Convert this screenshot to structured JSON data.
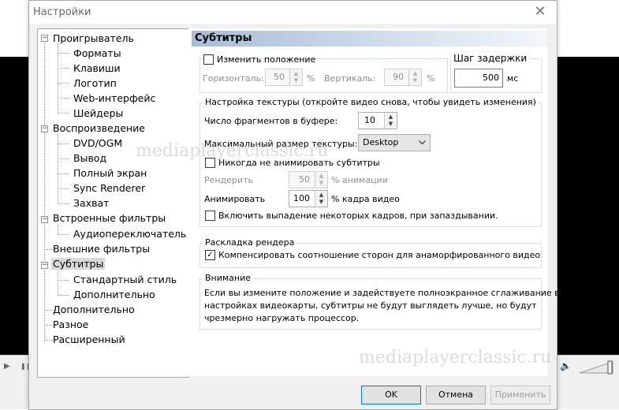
{
  "watermark": "mediaplayerclassic.ru",
  "dialog": {
    "title": "Настройки",
    "close_glyph": "✕"
  },
  "tree": {
    "items": [
      {
        "label": "Проигрыватель",
        "level": 0,
        "expanded": true
      },
      {
        "label": "Форматы",
        "level": 1
      },
      {
        "label": "Клавиши",
        "level": 1
      },
      {
        "label": "Логотип",
        "level": 1
      },
      {
        "label": "Web-интерфейс",
        "level": 1
      },
      {
        "label": "Шейдеры",
        "level": 1
      },
      {
        "label": "Воспроизведение",
        "level": 0,
        "expanded": true
      },
      {
        "label": "DVD/OGM",
        "level": 1
      },
      {
        "label": "Вывод",
        "level": 1
      },
      {
        "label": "Полный экран",
        "level": 1
      },
      {
        "label": "Sync Renderer",
        "level": 1
      },
      {
        "label": "Захват",
        "level": 1
      },
      {
        "label": "Встроенные фильтры",
        "level": 0,
        "expanded": true
      },
      {
        "label": "Аудиопереключатель",
        "level": 1
      },
      {
        "label": "Внешние фильтры",
        "level": 0
      },
      {
        "label": "Субтитры",
        "level": 0,
        "expanded": true,
        "selected": true
      },
      {
        "label": "Стандартный стиль",
        "level": 1
      },
      {
        "label": "Дополнительно",
        "level": 1
      },
      {
        "label": "Дополнительно",
        "level": 0
      },
      {
        "label": "Разное",
        "level": 0
      },
      {
        "label": "Расширенный",
        "level": 0
      }
    ]
  },
  "panel": {
    "title": "Субтитры",
    "position": {
      "checkbox_label": "Изменить положение",
      "checked": false,
      "horizontal_label": "Горизонталь:",
      "horizontal_value": "50",
      "horizontal_unit": "%",
      "vertical_label": "Вертикаль:",
      "vertical_value": "90",
      "vertical_unit": "%"
    },
    "delay": {
      "group_label": "Шаг задержки",
      "value": "500",
      "unit": "мс"
    },
    "texture": {
      "group_label": "Настройка текстуры (откройте видео снова, чтобы увидеть изменения)",
      "buffer_label": "Число фрагментов в буфере:",
      "buffer_value": "10",
      "max_texture_label": "Максимальный размер текстуры:",
      "max_texture_value": "Desktop",
      "never_animate_label": "Никогда не анимировать субтитры",
      "never_animate_checked": false,
      "render_label": "Рендерить",
      "render_value": "50",
      "render_unit": "% анимации",
      "animate_label": "Анимировать",
      "animate_value": "100",
      "animate_unit": "% кадра видео",
      "drop_frames_label": "Включить выпадение некоторых кадров, при запаздывании.",
      "drop_frames_checked": false
    },
    "layout": {
      "group_label": "Раскладка рендера",
      "compensate_label": "Компенсировать соотношение сторон для анаморфированного видео",
      "compensate_checked": true
    },
    "warning": {
      "group_label": "Внимание",
      "text_line1": "Если вы измените положение и задействуете полноэкранное сглаживание в",
      "text_line2": "настройках видеокарты, субтитры не будут выглядеть лучше, но будут",
      "text_line3": "чрезмерно нагружать процессор."
    }
  },
  "buttons": {
    "ok": "OK",
    "cancel": "Отмена",
    "apply": "Применить"
  },
  "player": {
    "play_glyph": "▶",
    "pause_glyph": "❚❚",
    "volume_glyph": "🔈"
  }
}
